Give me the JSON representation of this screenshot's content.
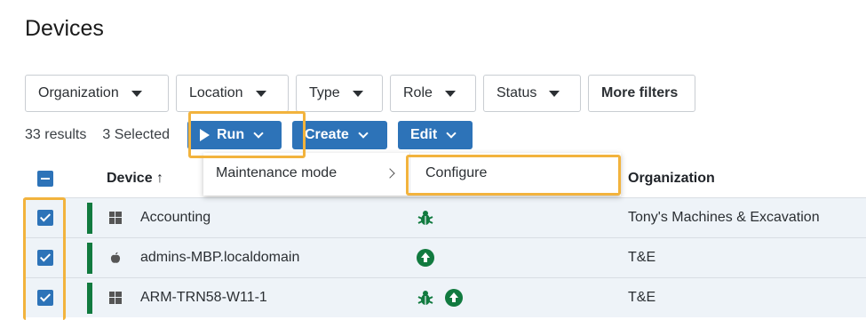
{
  "page": {
    "title": "Devices"
  },
  "filters": [
    {
      "label": "Organization"
    },
    {
      "label": "Location"
    },
    {
      "label": "Type"
    },
    {
      "label": "Role"
    },
    {
      "label": "Status"
    }
  ],
  "more_filters_label": "More filters",
  "toolbar": {
    "results": "33 results",
    "selected": "3 Selected",
    "run_label": "Run",
    "create_label": "Create",
    "edit_label": "Edit"
  },
  "run_menu": {
    "item_label": "Maintenance mode",
    "submenu_item_label": "Configure"
  },
  "table": {
    "columns": {
      "device": "Device ↑",
      "organization": "Organization"
    },
    "rows": [
      {
        "device": "Accounting",
        "os_icon": "windows-icon",
        "badges": [
          "bug-icon"
        ],
        "organization": "Tony's Machines & Excavation",
        "checked": true
      },
      {
        "device": "admins-MBP.localdomain",
        "os_icon": "apple-icon",
        "badges": [
          "update-arrow-icon"
        ],
        "organization": "T&E",
        "checked": true
      },
      {
        "device": "ARM-TRN58-W11-1",
        "os_icon": "windows-icon",
        "badges": [
          "bug-icon",
          "update-arrow-icon"
        ],
        "organization": "T&E",
        "checked": true
      }
    ]
  },
  "colors": {
    "accent": "#2d73b8",
    "status_green": "#117a3f",
    "highlight": "#f2b33d",
    "row_bg": "#eef3f8"
  }
}
